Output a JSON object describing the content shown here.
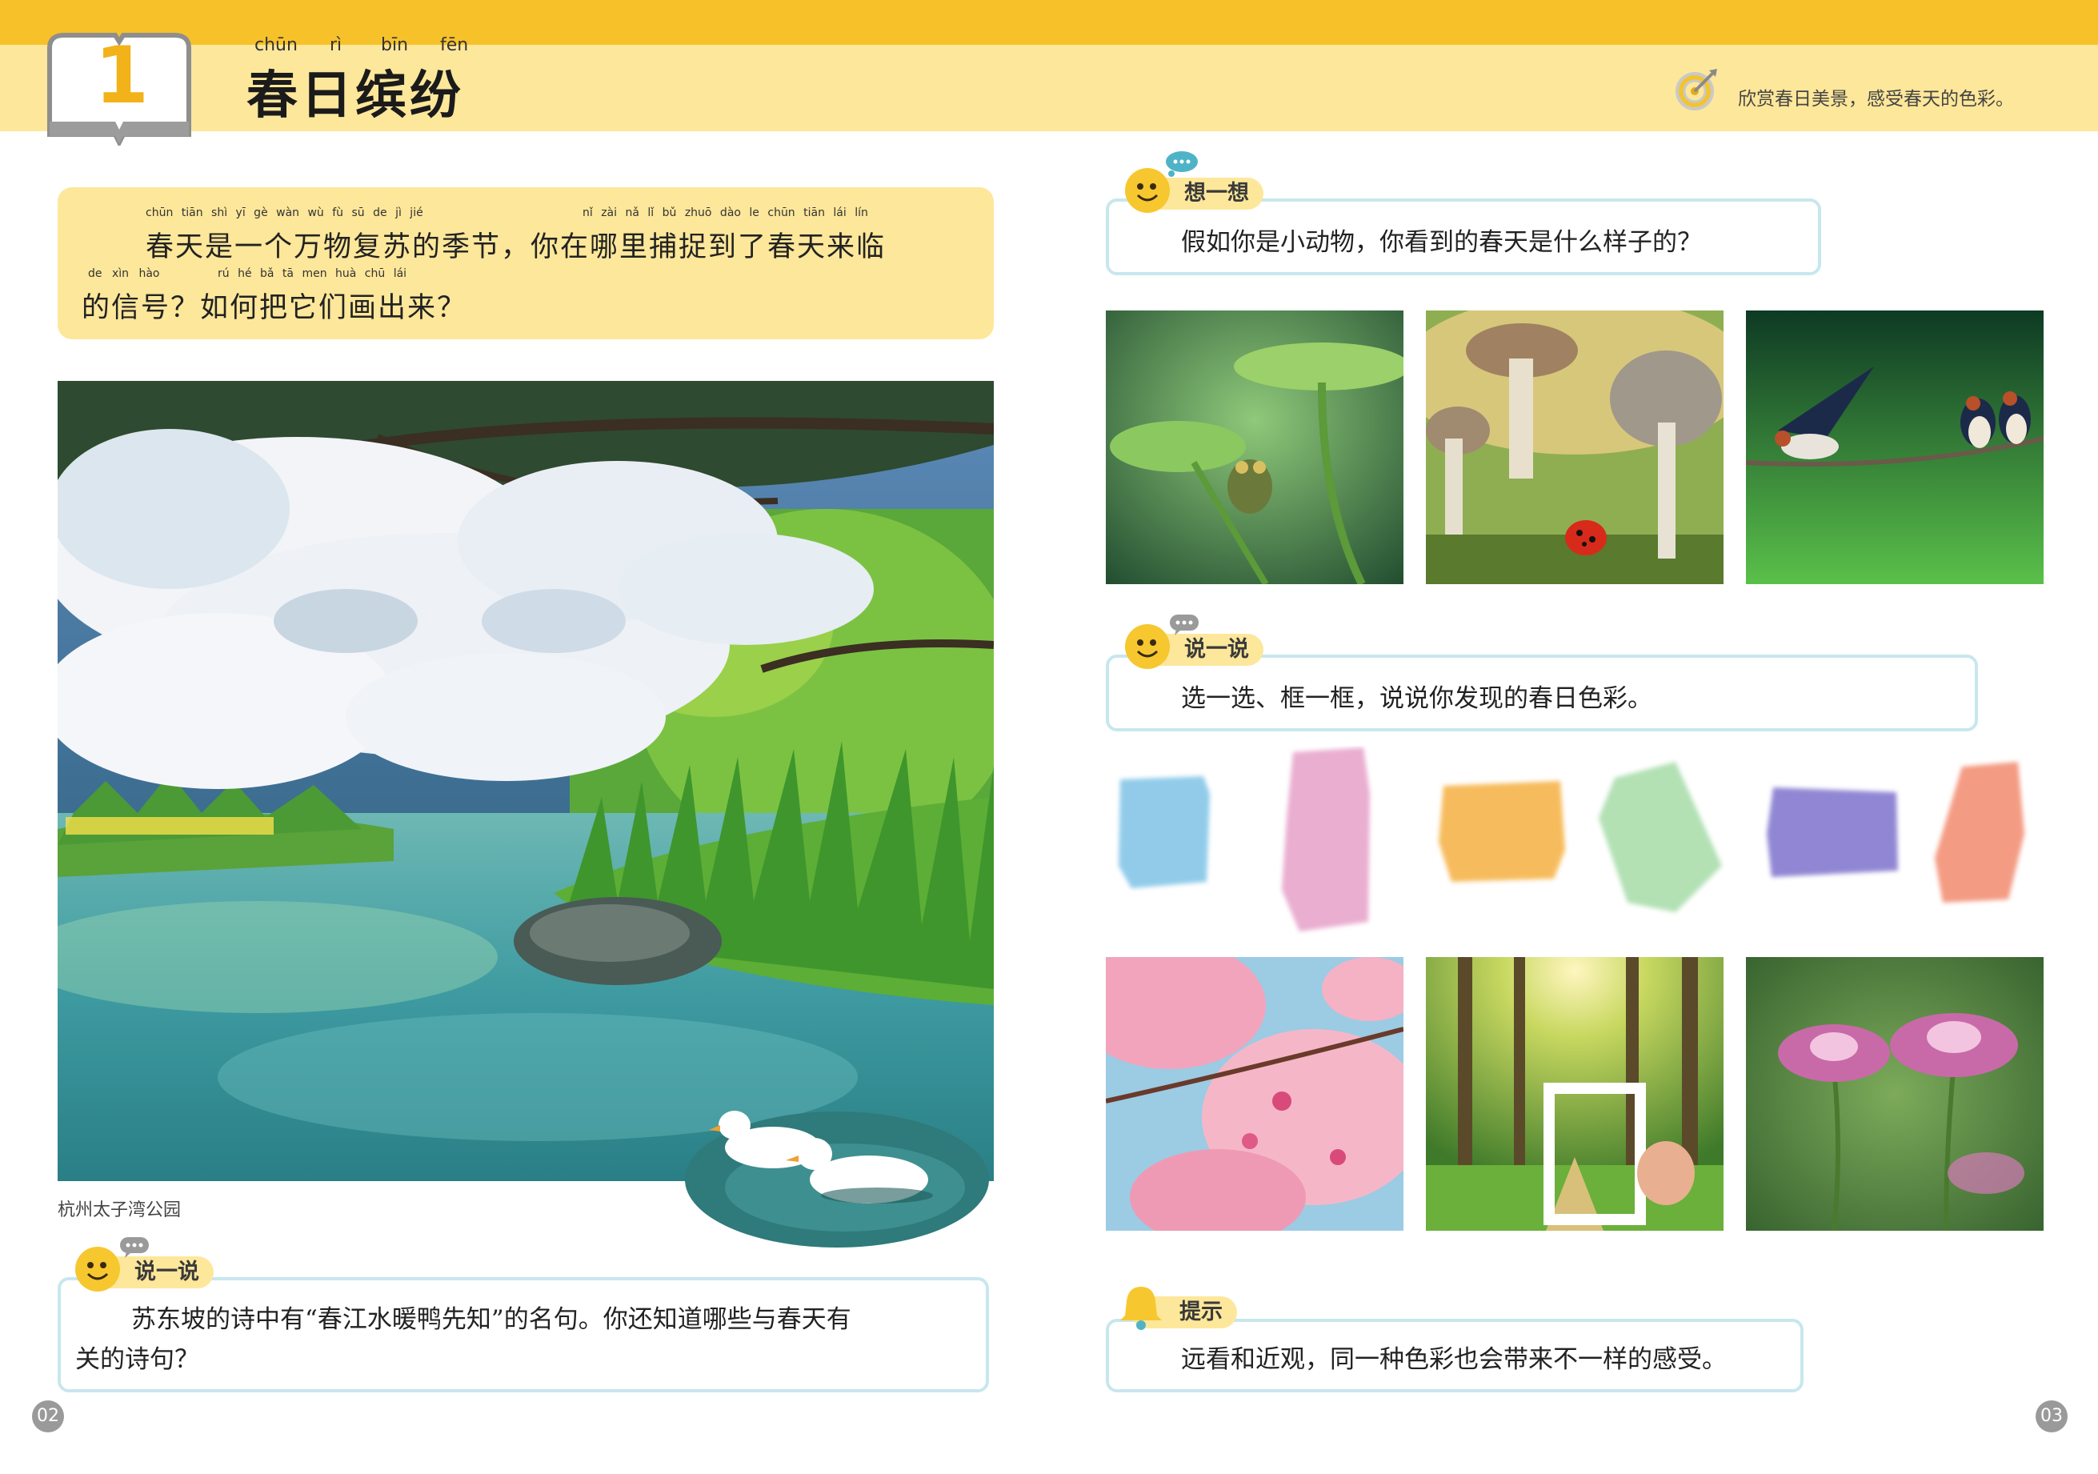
{
  "header": {
    "lesson_number": "1",
    "title_pinyin": [
      "chūn",
      "rì",
      "bīn",
      "fēn"
    ],
    "title": "春日缤纷",
    "goal": "欣赏春日美景，感受春天的色彩。"
  },
  "intro": {
    "pinyin_1": "chūn tiān shì yī gè wàn wù fù sū de jì jié",
    "pinyin_1b": "nǐ zài nǎ lǐ bǔ zhuō dào le chūn tiān lái lín",
    "line_1": "春天是一个万物复苏的季节，你在哪里捕捉到了春天来临",
    "pinyin_2": "de xìn hào",
    "pinyin_2b": "rú hé bǎ tā men huà chū lái",
    "line_2": "的信号？如何把它们画出来？"
  },
  "main_photo": {
    "caption": "杭州太子湾公园"
  },
  "left_talk": {
    "tag": "说一说",
    "text_1": "苏东坡的诗中有“春江水暖鸭先知”的名句。你还知道哪些与春天有",
    "text_2": "关的诗句？"
  },
  "think": {
    "tag": "想一想",
    "text": "假如你是小动物，你看到的春天是什么样子的？"
  },
  "right_talk": {
    "tag": "说一说",
    "text": "选一选、框一框，说说你发现的春日色彩。"
  },
  "swatch_colors": [
    "#7ec3e6",
    "#e6a0c8",
    "#f5b040",
    "#a6dca8",
    "#7e72cc",
    "#f28a6e"
  ],
  "tip": {
    "tag": "提示",
    "text": "远看和近观，同一种色彩也会带来不一样的感受。"
  },
  "pages": {
    "left": "02",
    "right": "03"
  }
}
